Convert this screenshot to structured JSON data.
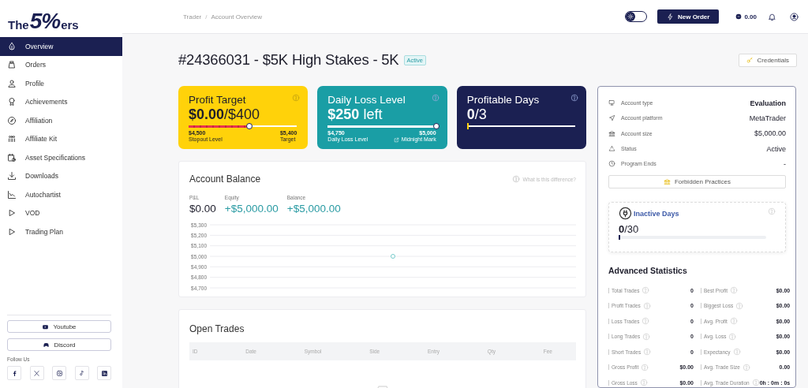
{
  "logo": {
    "prefix": "The",
    "mark": "5%",
    "suffix": "ers"
  },
  "sidebar": {
    "items": [
      {
        "label": "Overview",
        "selected": true
      },
      {
        "label": "Orders",
        "selected": false
      },
      {
        "label": "Profile",
        "selected": false
      },
      {
        "label": "Achievements",
        "selected": false
      },
      {
        "label": "Affiliation",
        "selected": false
      },
      {
        "label": "Affiliate Kit",
        "selected": false
      },
      {
        "label": "Asset Specifications",
        "selected": false
      },
      {
        "label": "Downloads",
        "selected": false
      },
      {
        "label": "Autochartist",
        "selected": false
      },
      {
        "label": "VOD",
        "selected": false
      },
      {
        "label": "Trading Plan",
        "selected": false
      }
    ],
    "links": [
      {
        "label": "Youtube"
      },
      {
        "label": "Discord"
      }
    ],
    "follow_label": "Follow Us"
  },
  "topbar": {
    "breadcrumb": [
      "Trader",
      "Account Overview"
    ],
    "breadcrumb_separator": "/",
    "theme_toggle": {
      "on": false
    },
    "new_order": "New Order",
    "balance": "0.00"
  },
  "page": {
    "title": "#24366031 - $5K High Stakes - 5K",
    "status": "Active",
    "credentials": "Credentials"
  },
  "cards": [
    {
      "kind": "profit",
      "title": "Profit Target",
      "value": "$0.00",
      "value_suffix": "/$400",
      "level": 0.56,
      "left_value": "$4,500",
      "left_label": "Stopout Level",
      "right_value": "$5,400",
      "right_label": "Target"
    },
    {
      "kind": "loss",
      "title": "Daily Loss Level",
      "value": "$250",
      "value_suffix": " left",
      "level": 1,
      "left_value": "$4,750",
      "left_label": "Daily Loss Level",
      "right_value": "$5,000",
      "right_label": "Midnight Mark"
    },
    {
      "kind": "days",
      "title": "Profitable Days",
      "value": "0",
      "value_suffix": "/3",
      "level": 0
    }
  ],
  "balance": {
    "title": "Account Balance",
    "help": "What is this difference?",
    "metrics": [
      {
        "label": "P&L",
        "value": "$0.00",
        "kind": "neutral"
      },
      {
        "label": "Equity",
        "value": "+$5,000.00",
        "kind": "positive"
      },
      {
        "label": "Balance",
        "value": "+$5,000.00",
        "kind": "positive"
      }
    ],
    "chart_data": {
      "type": "line",
      "grid": true,
      "marker": true,
      "ylim": [
        4700,
        5300
      ],
      "yticks": [
        {
          "value": 5300,
          "label": "$5,300"
        },
        {
          "value": 5200,
          "label": "$5,200"
        },
        {
          "value": 5100,
          "label": "$5,100"
        },
        {
          "value": 5000,
          "label": "$5,000"
        },
        {
          "value": 4900,
          "label": "$4,900"
        },
        {
          "value": 4800,
          "label": "$4,800"
        },
        {
          "value": 4700,
          "label": "$4,700"
        }
      ],
      "values": [
        5000
      ]
    }
  },
  "trades": {
    "title": "Open Trades",
    "columns": [
      "ID",
      "Date",
      "Symbol",
      "Side",
      "Entry",
      "Qty",
      "Fee"
    ]
  },
  "info": {
    "rows": [
      {
        "label": "Account type",
        "value": "Evaluation"
      },
      {
        "label": "Account platform",
        "value": "MetaTrader"
      },
      {
        "label": "Account size",
        "value": "$5,000.00"
      },
      {
        "label": "Status",
        "value": "Active"
      },
      {
        "label": "Program Ends",
        "value": "-"
      }
    ],
    "forbidden": "Forbidden Practices",
    "inactive": {
      "title": "Inactive Days",
      "value": "0",
      "total": "/30",
      "level": 0
    }
  },
  "stats": {
    "title": "Advanced Statistics",
    "items": [
      {
        "label": "Total Trades",
        "value": "0"
      },
      {
        "label": "Best Profit",
        "value": "$0.00"
      },
      {
        "label": "Profit Trades",
        "value": "0"
      },
      {
        "label": "Biggest Loss",
        "value": "$0.00"
      },
      {
        "label": "Loss Trades",
        "value": "0"
      },
      {
        "label": "Avg. Profit",
        "value": "$0.00"
      },
      {
        "label": "Long Trades",
        "value": "0"
      },
      {
        "label": "Avg. Loss",
        "value": "$0.00"
      },
      {
        "label": "Short Trades",
        "value": "0"
      },
      {
        "label": "Expectancy",
        "value": "$0.00"
      },
      {
        "label": "Gross Profit",
        "value": "$0.00"
      },
      {
        "label": "Avg. Trade Size",
        "value": "0.00"
      },
      {
        "label": "Gross Loss",
        "value": "$0.00"
      },
      {
        "label": "Avg. Trade Duration",
        "value": "0h : 0m : 0s"
      }
    ]
  }
}
